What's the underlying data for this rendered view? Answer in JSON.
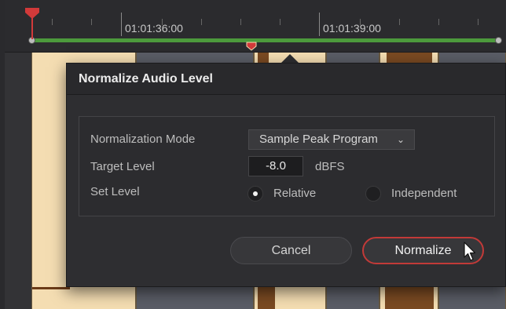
{
  "timeline": {
    "timecodes": [
      "01:01:36:00",
      "01:01:39:00"
    ],
    "colors": {
      "in_out_range": "#4c9a3c",
      "playhead": "#d23a3a",
      "clip_audio": "#f4ddb2",
      "waveform": "#7a4a22"
    }
  },
  "dialog": {
    "title": "Normalize Audio Level",
    "normalization_mode_label": "Normalization Mode",
    "normalization_mode_value": "Sample Peak Program",
    "target_level_label": "Target Level",
    "target_level_value": "-8.0",
    "target_level_unit": "dBFS",
    "set_level_label": "Set Level",
    "set_level_options": [
      "Relative",
      "Independent"
    ],
    "set_level_selected": "Relative",
    "cancel_label": "Cancel",
    "normalize_label": "Normalize",
    "accent_color": "#c23a38"
  }
}
